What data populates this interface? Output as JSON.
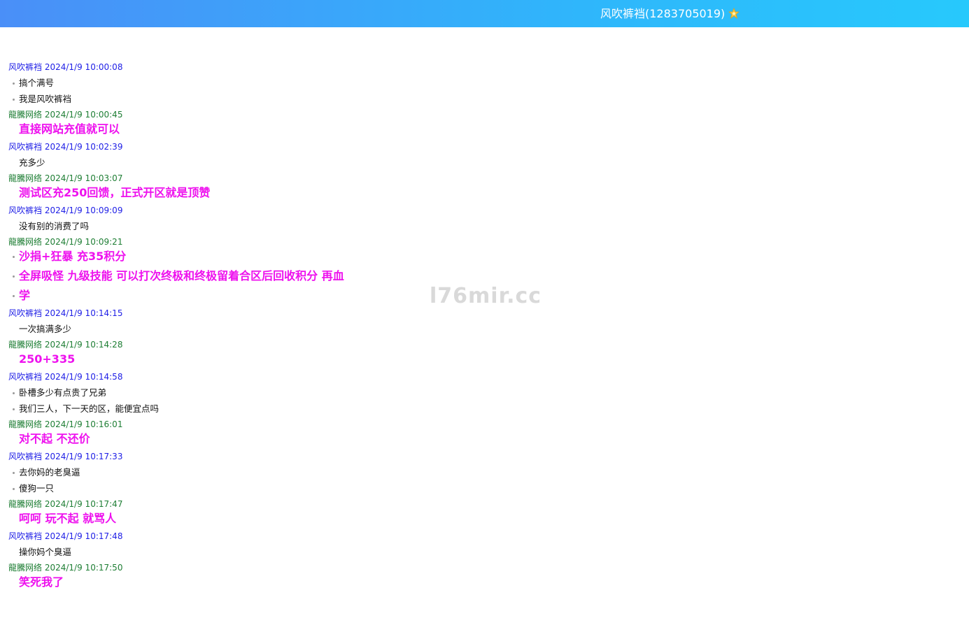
{
  "header": {
    "title": "风吹裤裆(1283705019)",
    "icon": "star-icon"
  },
  "watermark": "l76mir.cc",
  "messages": [
    {
      "sender": "风吹裤裆",
      "time": "2024/1/9 10:00:08",
      "kind": "user",
      "lines": [
        {
          "text": "搞个满号",
          "bullet": true
        },
        {
          "text": "我是风吹裤裆",
          "bullet": true
        }
      ]
    },
    {
      "sender": "龍騰网络",
      "time": "2024/1/9 10:00:45",
      "kind": "staff",
      "lines": [
        {
          "text": "直接网站充值就可以",
          "bullet": false
        }
      ]
    },
    {
      "sender": "风吹裤裆",
      "time": "2024/1/9 10:02:39",
      "kind": "user",
      "lines": [
        {
          "text": "充多少",
          "bullet": false
        }
      ]
    },
    {
      "sender": "龍騰网络",
      "time": "2024/1/9 10:03:07",
      "kind": "staff",
      "lines": [
        {
          "text": "测试区充250回馈，正式开区就是顶赞",
          "bullet": false
        }
      ]
    },
    {
      "sender": "风吹裤裆",
      "time": "2024/1/9 10:09:09",
      "kind": "user",
      "lines": [
        {
          "text": "没有别的消费了吗",
          "bullet": false
        }
      ]
    },
    {
      "sender": "龍騰网络",
      "time": "2024/1/9 10:09:21",
      "kind": "staff",
      "lines": [
        {
          "text": "沙捐+狂暴 充35积分",
          "bullet": true
        },
        {
          "text": "全屏吸怪 九级技能 可以打次终极和终极留着合区后回收积分 再血",
          "bullet": true
        },
        {
          "text": "学",
          "bullet": true
        }
      ]
    },
    {
      "sender": "风吹裤裆",
      "time": "2024/1/9 10:14:15",
      "kind": "user",
      "lines": [
        {
          "text": "一次搞满多少",
          "bullet": false
        }
      ]
    },
    {
      "sender": "龍騰网络",
      "time": "2024/1/9 10:14:28",
      "kind": "staff",
      "lines": [
        {
          "text": "250+335",
          "bullet": false
        }
      ]
    },
    {
      "sender": "风吹裤裆",
      "time": "2024/1/9 10:14:58",
      "kind": "user",
      "lines": [
        {
          "text": "卧槽多少有点贵了兄弟",
          "bullet": true
        },
        {
          "text": "我们三人，下一天的区，能便宜点吗",
          "bullet": true
        }
      ]
    },
    {
      "sender": "龍騰网络",
      "time": "2024/1/9 10:16:01",
      "kind": "staff",
      "lines": [
        {
          "text": "对不起 不还价",
          "bullet": false
        }
      ]
    },
    {
      "sender": "风吹裤裆",
      "time": "2024/1/9 10:17:33",
      "kind": "user",
      "lines": [
        {
          "text": "去你妈的老臭逼",
          "bullet": true
        },
        {
          "text": "傻狗一只",
          "bullet": true
        }
      ]
    },
    {
      "sender": "龍騰网络",
      "time": "2024/1/9 10:17:47",
      "kind": "staff",
      "lines": [
        {
          "text": "呵呵 玩不起 就骂人",
          "bullet": false
        }
      ]
    },
    {
      "sender": "风吹裤裆",
      "time": "2024/1/9 10:17:48",
      "kind": "user",
      "lines": [
        {
          "text": "操你妈个臭逼",
          "bullet": false
        }
      ]
    },
    {
      "sender": "龍騰网络",
      "time": "2024/1/9 10:17:50",
      "kind": "staff",
      "lines": [
        {
          "text": "笑死我了",
          "bullet": false
        }
      ]
    }
  ]
}
